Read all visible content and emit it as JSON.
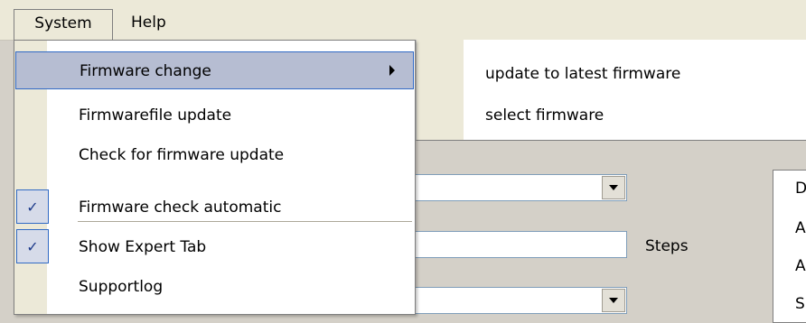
{
  "menubar": {
    "system_label": "System",
    "help_label": "Help"
  },
  "system_menu": {
    "items": [
      {
        "label": "Firmware change"
      },
      {
        "label": "Firmwarefile update"
      },
      {
        "label": "Check for firmware update"
      },
      {
        "label": "Firmware check automatic",
        "checked": true
      },
      {
        "label": "Show Expert Tab",
        "checked": true
      },
      {
        "label": "Supportlog"
      }
    ]
  },
  "firmware_submenu": {
    "items": [
      {
        "label": "update to latest firmware"
      },
      {
        "label": "select firmware"
      }
    ]
  },
  "background": {
    "steps_label": "Steps",
    "right_box_letters": [
      "D",
      "A",
      "A",
      "S"
    ]
  },
  "icons": {
    "check": "✓",
    "submenu_arrow": "triangle-right",
    "combo_arrow": "triangle-down"
  }
}
